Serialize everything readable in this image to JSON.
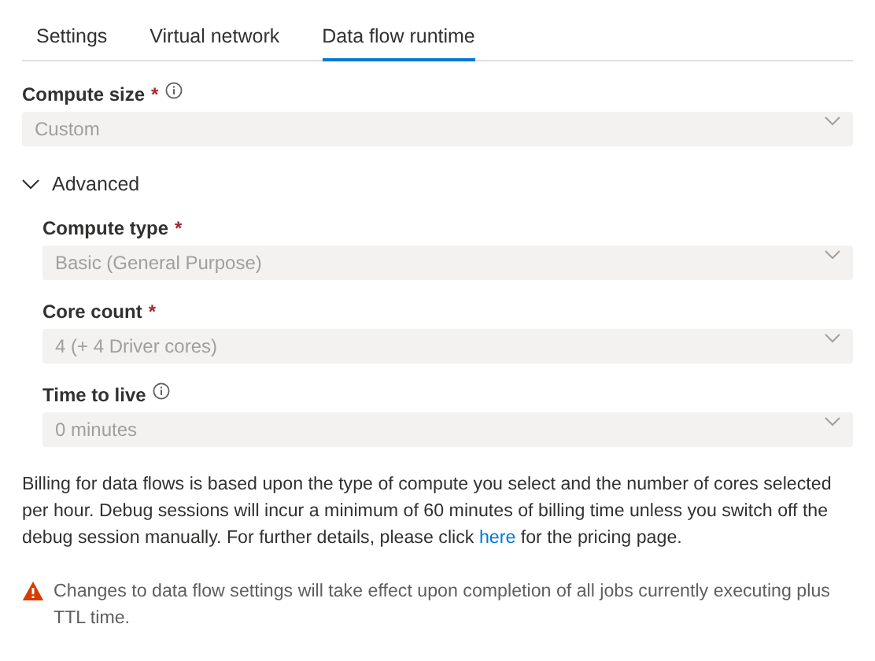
{
  "tabs": [
    {
      "label": "Settings",
      "selected": false
    },
    {
      "label": "Virtual network",
      "selected": false
    },
    {
      "label": "Data flow runtime",
      "selected": true
    }
  ],
  "compute_size": {
    "label": "Compute size",
    "required_mark": "*",
    "info": true,
    "value": "Custom",
    "disabled": true
  },
  "advanced": {
    "label": "Advanced",
    "expanded": true,
    "fields": [
      {
        "label": "Compute type",
        "required_mark": "*",
        "info": false,
        "value": "Basic (General Purpose)",
        "disabled": true
      },
      {
        "label": "Core count",
        "required_mark": "*",
        "info": false,
        "value": "4 (+ 4 Driver cores)",
        "disabled": true
      },
      {
        "label": "Time to live",
        "info": true,
        "value": "0 minutes",
        "disabled": true
      }
    ]
  },
  "billing_note": {
    "text_before": "Billing for data flows is based upon the type of compute you select and the number of cores selected per hour. Debug sessions will incur a minimum of 60 minutes of billing time unless you switch off the debug session manually. For further details, please click",
    "link": "here",
    "text_after": "for the pricing page."
  },
  "warning": {
    "text": "Changes to data flow settings will take effect upon completion of all jobs currently executing plus TTL time."
  }
}
